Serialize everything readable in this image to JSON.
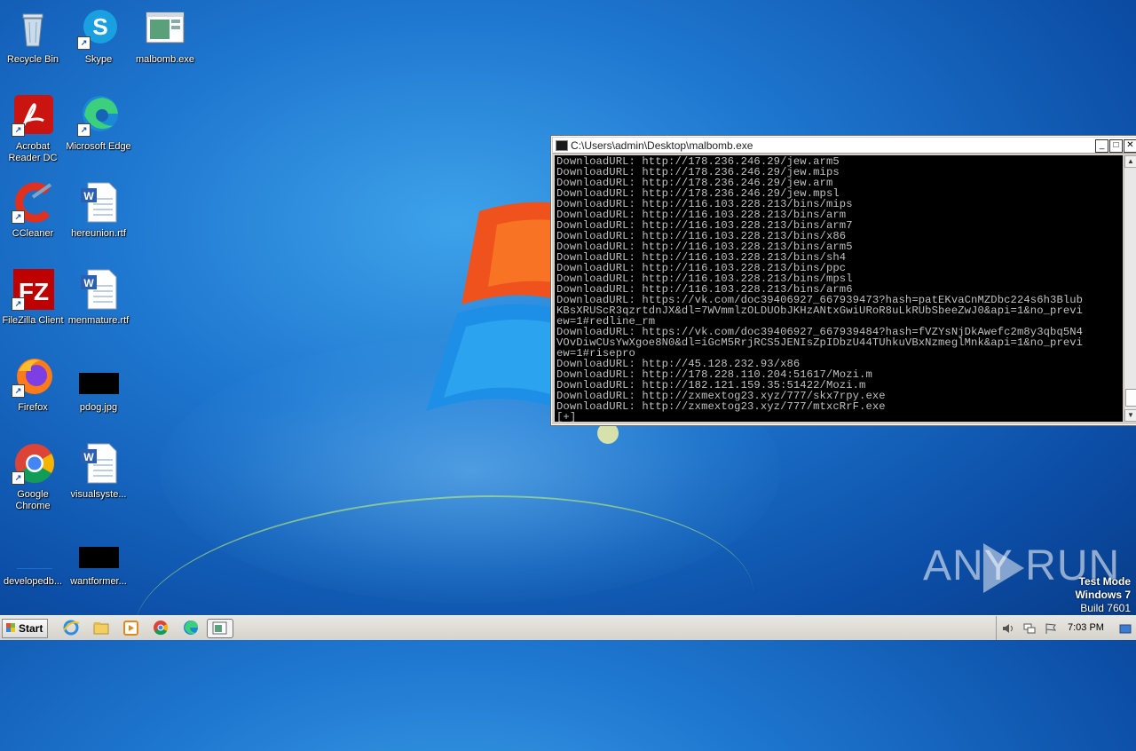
{
  "desktop": {
    "icons": [
      {
        "label": "Recycle Bin"
      },
      {
        "label": "Skype"
      },
      {
        "label": "malbomb.exe"
      },
      {
        "label": "Acrobat Reader DC"
      },
      {
        "label": "Microsoft Edge"
      },
      {
        "label": "CCleaner"
      },
      {
        "label": "hereunion.rtf"
      },
      {
        "label": "FileZilla Client"
      },
      {
        "label": "menmature.rtf"
      },
      {
        "label": "Firefox"
      },
      {
        "label": "pdog.jpg"
      },
      {
        "label": "Google Chrome"
      },
      {
        "label": "visualsyste..."
      },
      {
        "label": "developedb..."
      },
      {
        "label": "wantformer..."
      }
    ]
  },
  "console": {
    "title": "C:\\Users\\admin\\Desktop\\malbomb.exe",
    "lines": [
      "DownloadURL: http://178.236.246.29/jew.arm5",
      "DownloadURL: http://178.236.246.29/jew.mips",
      "DownloadURL: http://178.236.246.29/jew.arm",
      "DownloadURL: http://178.236.246.29/jew.mpsl",
      "DownloadURL: http://116.103.228.213/bins/mips",
      "DownloadURL: http://116.103.228.213/bins/arm",
      "DownloadURL: http://116.103.228.213/bins/arm7",
      "DownloadURL: http://116.103.228.213/bins/x86",
      "DownloadURL: http://116.103.228.213/bins/arm5",
      "DownloadURL: http://116.103.228.213/bins/sh4",
      "DownloadURL: http://116.103.228.213/bins/ppc",
      "DownloadURL: http://116.103.228.213/bins/mpsl",
      "DownloadURL: http://116.103.228.213/bins/arm6",
      "DownloadURL: https://vk.com/doc39406927_667939473?hash=patEKvaCnMZDbc224s6h3Blub",
      "KBsXRUScR3qzrtdnJX&dl=7WVmmlzOLDUObJKHzANtxGwiURoR8uLkRUbSbeeZwJ0&api=1&no_previ",
      "ew=1#redline_rm",
      "DownloadURL: https://vk.com/doc39406927_667939484?hash=fVZYsNjDkAwefc2m8y3qbq5N4",
      "VOvDiwCUsYwXgoe8N0&dl=iGcM5RrjRCS5JENIsZpIDbzU44TUhkuVBxNzmeglMnk&api=1&no_previ",
      "ew=1#risepro",
      "DownloadURL: http://45.128.232.93/x86",
      "DownloadURL: http://178.228.110.204:51617/Mozi.m",
      "DownloadURL: http://182.121.159.35:51422/Mozi.m",
      "DownloadURL: http://zxmextog23.xyz/777/skx7rpy.exe",
      "DownloadURL: http://zxmextog23.xyz/777/mtxcRrF.exe",
      "[+]"
    ]
  },
  "watermark": {
    "text": "ANY RUN"
  },
  "os_info": {
    "line1": "Test Mode",
    "line2": "Windows 7",
    "line3": "Build 7601"
  },
  "taskbar": {
    "start_label": "Start",
    "clock": "7:03 PM"
  }
}
